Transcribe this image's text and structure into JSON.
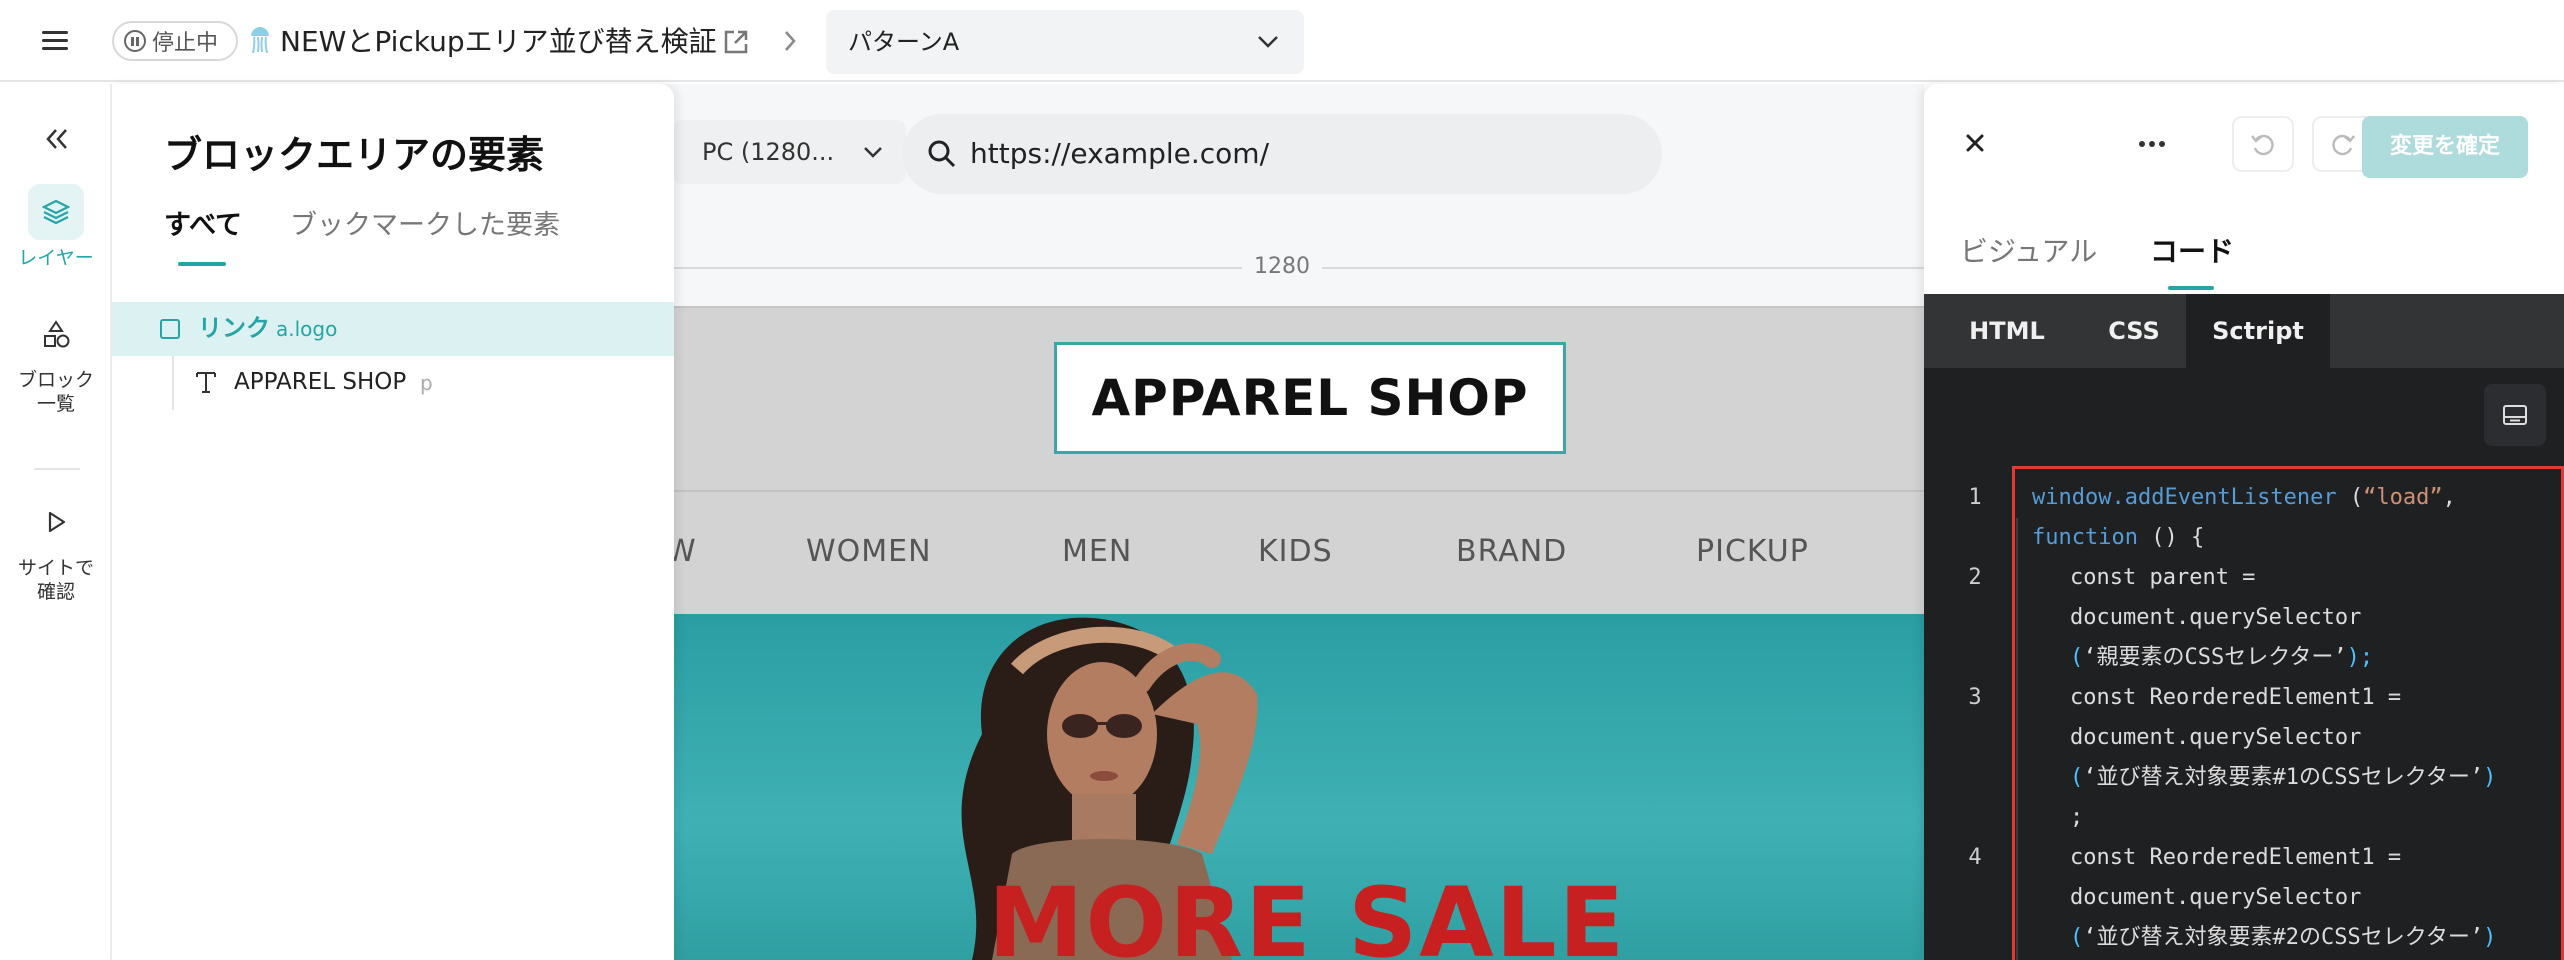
{
  "topbar": {
    "status": "停止中",
    "project_title": "NEWとPickupエリア並び替え検証",
    "pattern": "パターンA"
  },
  "rail": {
    "items": [
      {
        "label": "レイヤー",
        "active": true
      },
      {
        "label": "ブロック\n一覧",
        "active": false
      },
      {
        "label": "サイトで\n確認",
        "active": false
      }
    ]
  },
  "layers": {
    "title": "ブロックエリアの要素",
    "tabs": [
      "すべて",
      "ブックマークした要素"
    ],
    "tree": [
      {
        "label": "リンク",
        "tag": "a.logo",
        "selected": true
      },
      {
        "label": "APPAREL SHOP",
        "tag": "p",
        "selected": false
      }
    ]
  },
  "canvas": {
    "device": "PC (1280...",
    "url": "https://example.com/",
    "ruler_width": "1280",
    "site": {
      "logo": "APPAREL SHOP",
      "nav": [
        "W",
        "WOMEN",
        "MEN",
        "KIDS",
        "BRAND",
        "PICKUP"
      ],
      "hero_text": "MORE SALE"
    }
  },
  "panel": {
    "confirm_label": "変更を確定",
    "modes": [
      "ビジュアル",
      "コード"
    ],
    "code_tabs": [
      "HTML",
      "CSS",
      "Sctript"
    ],
    "code_lines": [
      {
        "num": "1",
        "parts": [
          "window.addEventListener",
          " (",
          "“load”",
          ",",
          "function",
          " () {"
        ]
      },
      {
        "num": "2",
        "parts": [
          "const parent =",
          "document.querySelector",
          "(",
          "‘親要素のCSSセレクター’",
          ");"
        ]
      },
      {
        "num": "3",
        "parts": [
          "const ReorderedElement1 =",
          "document.querySelector",
          "(",
          "‘並び替え対象要素#1のCSSセレクター’",
          ")",
          ";"
        ]
      },
      {
        "num": "4",
        "parts": [
          "const ReorderedElement1 =",
          "document.querySelector",
          "(",
          "‘並び替え対象要素#2のCSSセレクター’",
          ")"
        ]
      }
    ]
  },
  "colors": {
    "accent": "#26a5a7",
    "accent_light": "#dcf1f1",
    "confirm_disabled": "#aedbdb",
    "editor_bg": "#1f2022",
    "highlight_border": "#e53935",
    "hero_text": "#c62020"
  },
  "icons": [
    "menu-icon",
    "pause-icon",
    "jellyfish-icon",
    "external-link-icon",
    "chevron-right-icon",
    "chevron-down-icon",
    "double-chevron-left-icon",
    "layers-icon",
    "shapes-icon",
    "play-icon",
    "checkbox-icon",
    "text-icon",
    "search-icon",
    "close-icon",
    "more-icon",
    "undo-icon",
    "redo-icon",
    "panel-layout-icon"
  ]
}
